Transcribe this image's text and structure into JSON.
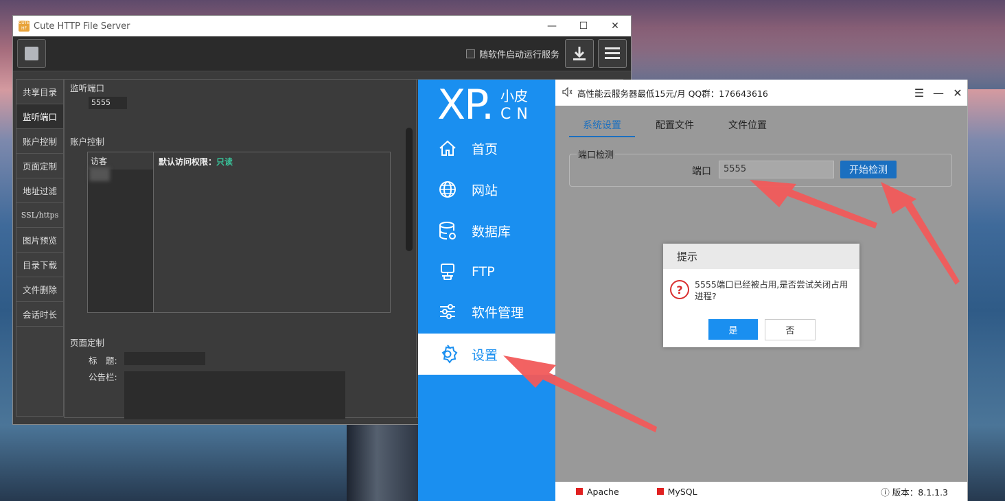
{
  "cute_window": {
    "title": "Cute HTTP File Server",
    "app_icon_text": "CUTE\nHF",
    "autostart_label": "随软件启动运行服务",
    "sidebar": [
      {
        "label": "共享目录"
      },
      {
        "label": "监听端口"
      },
      {
        "label": "账户控制"
      },
      {
        "label": "页面定制"
      },
      {
        "label": "地址过滤"
      },
      {
        "label": "SSL/https"
      },
      {
        "label": "图片预览"
      },
      {
        "label": "目录下载"
      },
      {
        "label": "文件删除"
      },
      {
        "label": "会话时长"
      }
    ],
    "listen_port": {
      "heading": "监听端口",
      "value": "5555"
    },
    "account": {
      "heading": "账户控制",
      "list_header": "访客",
      "default_perm_label": "默认访问权限：",
      "default_perm_value": "只读"
    },
    "page_custom": {
      "heading": "页面定制",
      "title_label": "标　题:",
      "notice_label": "公告栏:"
    }
  },
  "xp_window": {
    "logo": {
      "main": "XP.",
      "cn_top": "小皮",
      "cn_bottom": "CN"
    },
    "ad_text": "高性能云服务器最低15元/月  QQ群：176643616",
    "nav": [
      {
        "label": "首页",
        "icon": "home-icon"
      },
      {
        "label": "网站",
        "icon": "globe-icon"
      },
      {
        "label": "数据库",
        "icon": "database-icon"
      },
      {
        "label": "FTP",
        "icon": "ftp-icon"
      },
      {
        "label": "软件管理",
        "icon": "sliders-icon"
      },
      {
        "label": "设置",
        "icon": "gear-icon",
        "active": true
      }
    ],
    "tabs": [
      "系统设置",
      "配置文件",
      "文件位置"
    ],
    "port_check": {
      "group_title": "端口检测",
      "label": "端口",
      "value": "5555",
      "button": "开始检测"
    },
    "status": {
      "apache": "Apache",
      "mysql": "MySQL",
      "version": "版本：8.1.1.3"
    }
  },
  "dialog": {
    "title": "提示",
    "message": "5555端口已经被占用,是否尝试关闭占用进程?",
    "yes": "是",
    "no": "否"
  },
  "colors": {
    "xp_blue": "#1a8ff0",
    "annotation_red": "#f25a5a"
  }
}
